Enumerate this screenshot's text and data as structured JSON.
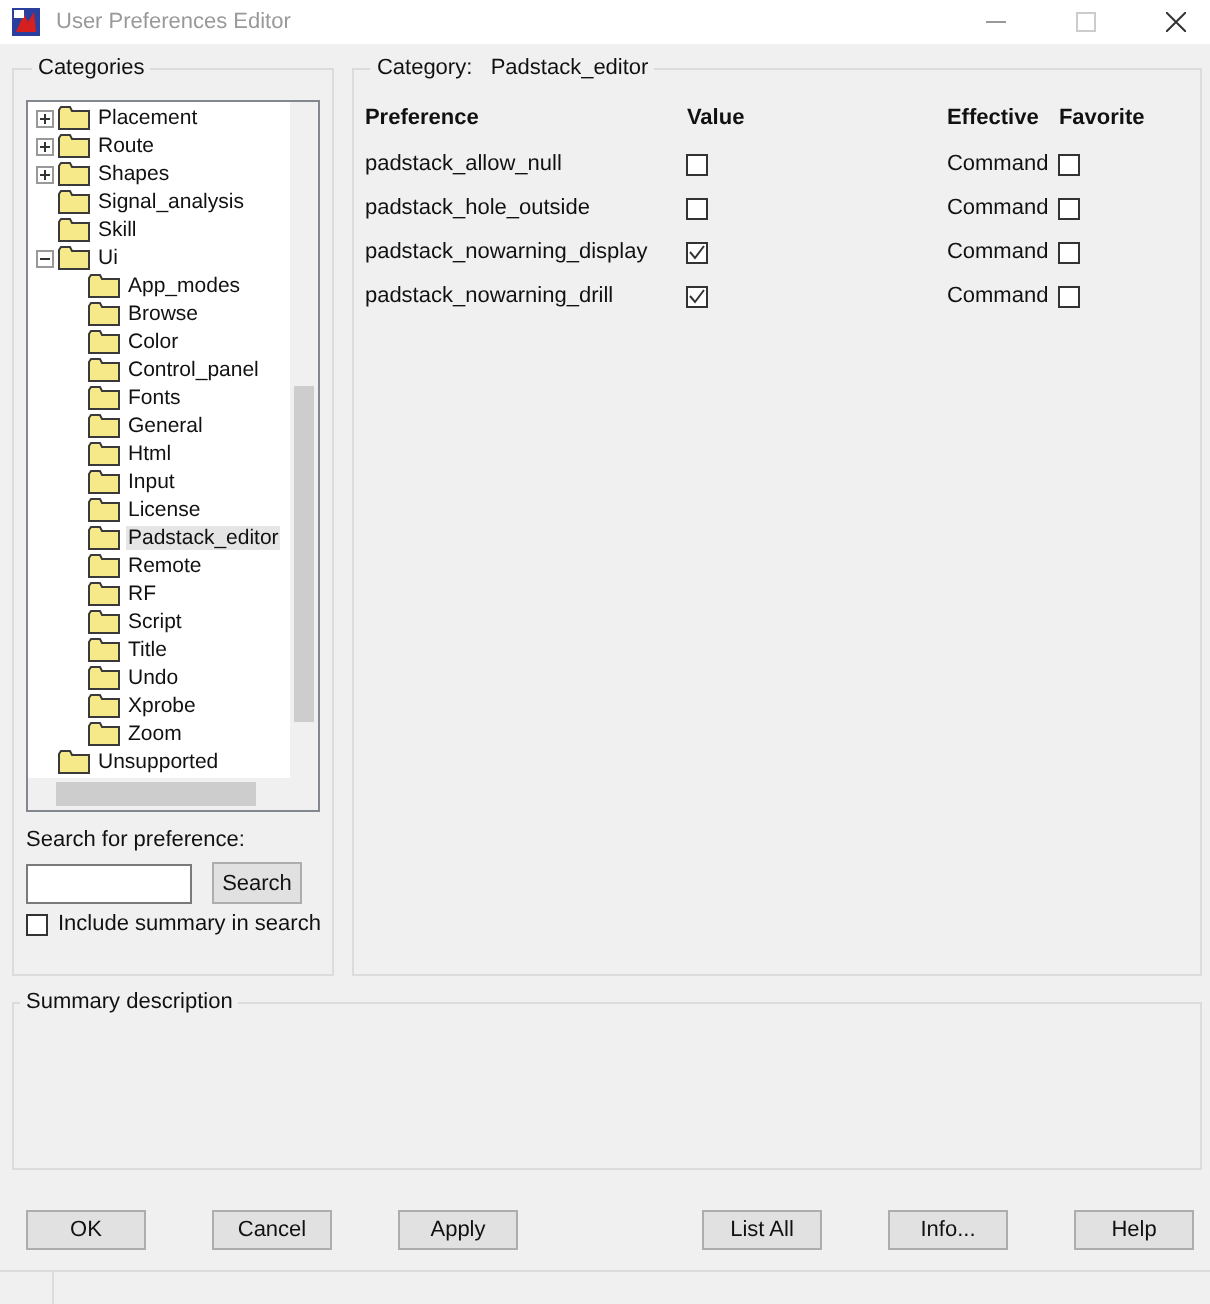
{
  "window": {
    "title": "User Preferences Editor"
  },
  "categories": {
    "title": "Categories",
    "tree": [
      {
        "label": "Placement",
        "expanded": false,
        "selected": false
      },
      {
        "label": "Route",
        "expanded": false,
        "selected": false
      },
      {
        "label": "Shapes",
        "expanded": false,
        "selected": false
      },
      {
        "label": "Signal_analysis",
        "selected": false
      },
      {
        "label": "Skill",
        "selected": false
      },
      {
        "label": "Ui",
        "expanded": true,
        "selected": false,
        "children": [
          {
            "label": "App_modes",
            "selected": false
          },
          {
            "label": "Browse",
            "selected": false
          },
          {
            "label": "Color",
            "selected": false
          },
          {
            "label": "Control_panel",
            "selected": false
          },
          {
            "label": "Fonts",
            "selected": false
          },
          {
            "label": "General",
            "selected": false
          },
          {
            "label": "Html",
            "selected": false
          },
          {
            "label": "Input",
            "selected": false
          },
          {
            "label": "License",
            "selected": false
          },
          {
            "label": "Padstack_editor",
            "selected": true
          },
          {
            "label": "Remote",
            "selected": false
          },
          {
            "label": "RF",
            "selected": false
          },
          {
            "label": "Script",
            "selected": false
          },
          {
            "label": "Title",
            "selected": false
          },
          {
            "label": "Undo",
            "selected": false
          },
          {
            "label": "Xprobe",
            "selected": false
          },
          {
            "label": "Zoom",
            "selected": false
          }
        ]
      },
      {
        "label": "Unsupported",
        "selected": false
      }
    ]
  },
  "search": {
    "label": "Search for preference:",
    "button": "Search",
    "include_summary": {
      "label": "Include summary in search",
      "checked": false
    }
  },
  "category": {
    "label": "Category:",
    "value": "Padstack_editor"
  },
  "table": {
    "columns": [
      "Preference",
      "Value",
      "Effective",
      "Favorite"
    ],
    "rows": [
      {
        "preference": "padstack_allow_null",
        "value": false,
        "effective": "Command",
        "favorite": false
      },
      {
        "preference": "padstack_hole_outside",
        "value": false,
        "effective": "Command",
        "favorite": false
      },
      {
        "preference": "padstack_nowarning_display",
        "value": true,
        "effective": "Command",
        "favorite": false
      },
      {
        "preference": "padstack_nowarning_drill",
        "value": true,
        "effective": "Command",
        "favorite": false
      }
    ]
  },
  "summary": {
    "title": "Summary description"
  },
  "buttons": [
    "OK",
    "Cancel",
    "Apply",
    "List All",
    "Info...",
    "Help"
  ]
}
